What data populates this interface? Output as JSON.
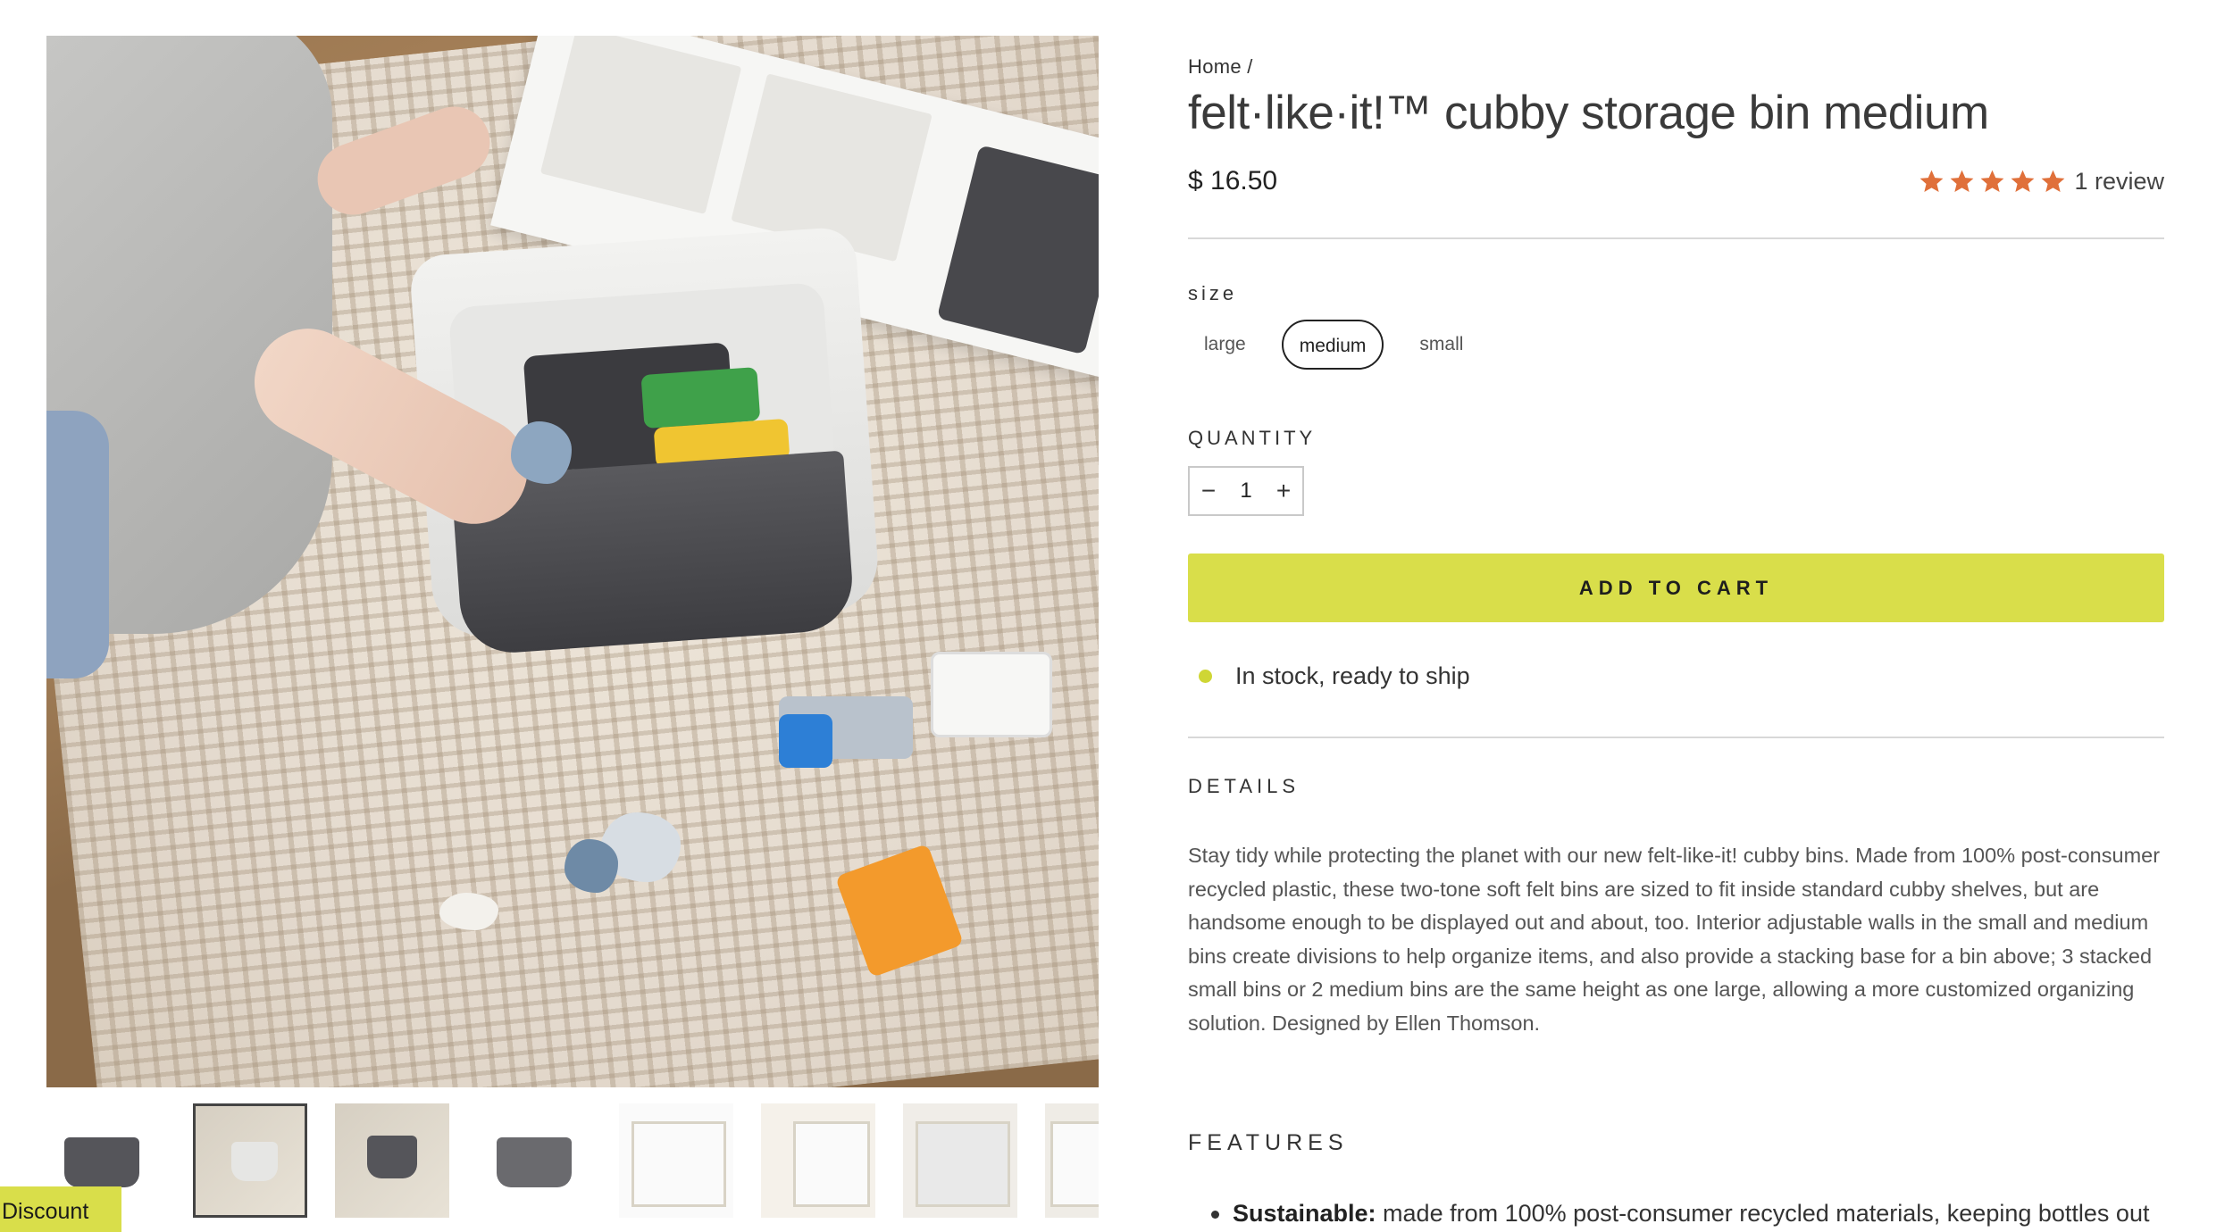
{
  "breadcrumb": {
    "home": "Home /"
  },
  "product": {
    "title": "felt·like·it!™ cubby storage bin medium",
    "price": "$ 16.50",
    "rating": 5,
    "reviews_label": "1 review"
  },
  "size": {
    "label": "size",
    "options": [
      "large",
      "medium",
      "small"
    ],
    "selected": "medium"
  },
  "quantity": {
    "label": "QUANTITY",
    "value": "1",
    "minus": "−",
    "plus": "+"
  },
  "cart": {
    "add_label": "ADD TO CART"
  },
  "stock": {
    "text": "In stock, ready to ship"
  },
  "details": {
    "heading": "DETAILS",
    "body": "Stay tidy while protecting the planet with our new felt-like-it! cubby bins. Made from 100% post-consumer recycled plastic, these two-tone soft felt bins are sized to fit inside standard cubby shelves, but are handsome enough to be displayed out and about, too. Interior adjustable walls in the small and medium bins create divisions to help organize items, and also provide a stacking base for a bin above; 3 stacked small bins or 2 medium bins are the same height as one large, allowing a more customized organizing solution. Designed by Ellen Thomson."
  },
  "features": {
    "heading": "FEATURES",
    "items": [
      {
        "bold": "Sustainable:",
        "text": " made from 100% post-consumer recycled materials, keeping bottles out"
      }
    ]
  },
  "discount": {
    "label": "Discount"
  },
  "colors": {
    "accent": "#d9de4a",
    "star": "#e0703a",
    "stock_dot": "#cfd635"
  }
}
